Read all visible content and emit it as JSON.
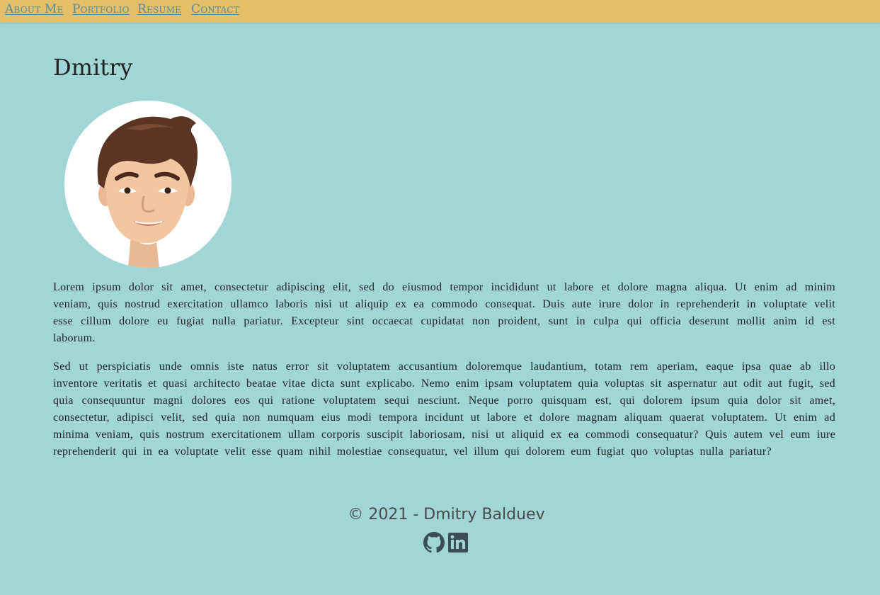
{
  "nav": {
    "items": [
      {
        "label": "About Me"
      },
      {
        "label": "Portfolio"
      },
      {
        "label": "Resume"
      },
      {
        "label": "Contact"
      }
    ]
  },
  "main": {
    "title": "Dmitry",
    "avatar_icon": "memoji-avatar",
    "paragraphs": [
      "Lorem ipsum dolor sit amet, consectetur adipiscing elit, sed do eiusmod tempor incididunt ut labore et dolore magna aliqua. Ut enim ad minim veniam, quis nostrud exercitation ullamco laboris nisi ut aliquip ex ea commodo consequat. Duis aute irure dolor in reprehenderit in voluptate velit esse cillum dolore eu fugiat nulla pariatur. Excepteur sint occaecat cupidatat non proident, sunt in culpa qui officia deserunt mollit anim id est laborum.",
      "Sed ut perspiciatis unde omnis iste natus error sit voluptatem accusantium doloremque laudantium, totam rem aperiam, eaque ipsa quae ab illo inventore veritatis et quasi architecto beatae vitae dicta sunt explicabo. Nemo enim ipsam voluptatem quia voluptas sit aspernatur aut odit aut fugit, sed quia consequuntur magni dolores eos qui ratione voluptatem sequi nesciunt. Neque porro quisquam est, qui dolorem ipsum quia dolor sit amet, consectetur, adipisci velit, sed quia non numquam eius modi tempora incidunt ut labore et dolore magnam aliquam quaerat voluptatem. Ut enim ad minima veniam, quis nostrum exercitationem ullam corporis suscipit laboriosam, nisi ut aliquid ex ea commodi consequatur? Quis autem vel eum iure reprehenderit qui in ea voluptate velit esse quam nihil molestiae consequatur, vel illum qui dolorem eum fugiat quo voluptas nulla pariatur?"
    ]
  },
  "footer": {
    "copyright": "© 2021 - Dmitry Balduev",
    "social": [
      {
        "icon": "github-icon"
      },
      {
        "icon": "linkedin-icon"
      }
    ]
  },
  "colors": {
    "background": "#a1d6d7",
    "navbar": "#e5be6a",
    "nav_link": "#4e8fa3",
    "text": "#222222",
    "footer_text": "#4a4a4a",
    "icon": "#3d4d55"
  }
}
